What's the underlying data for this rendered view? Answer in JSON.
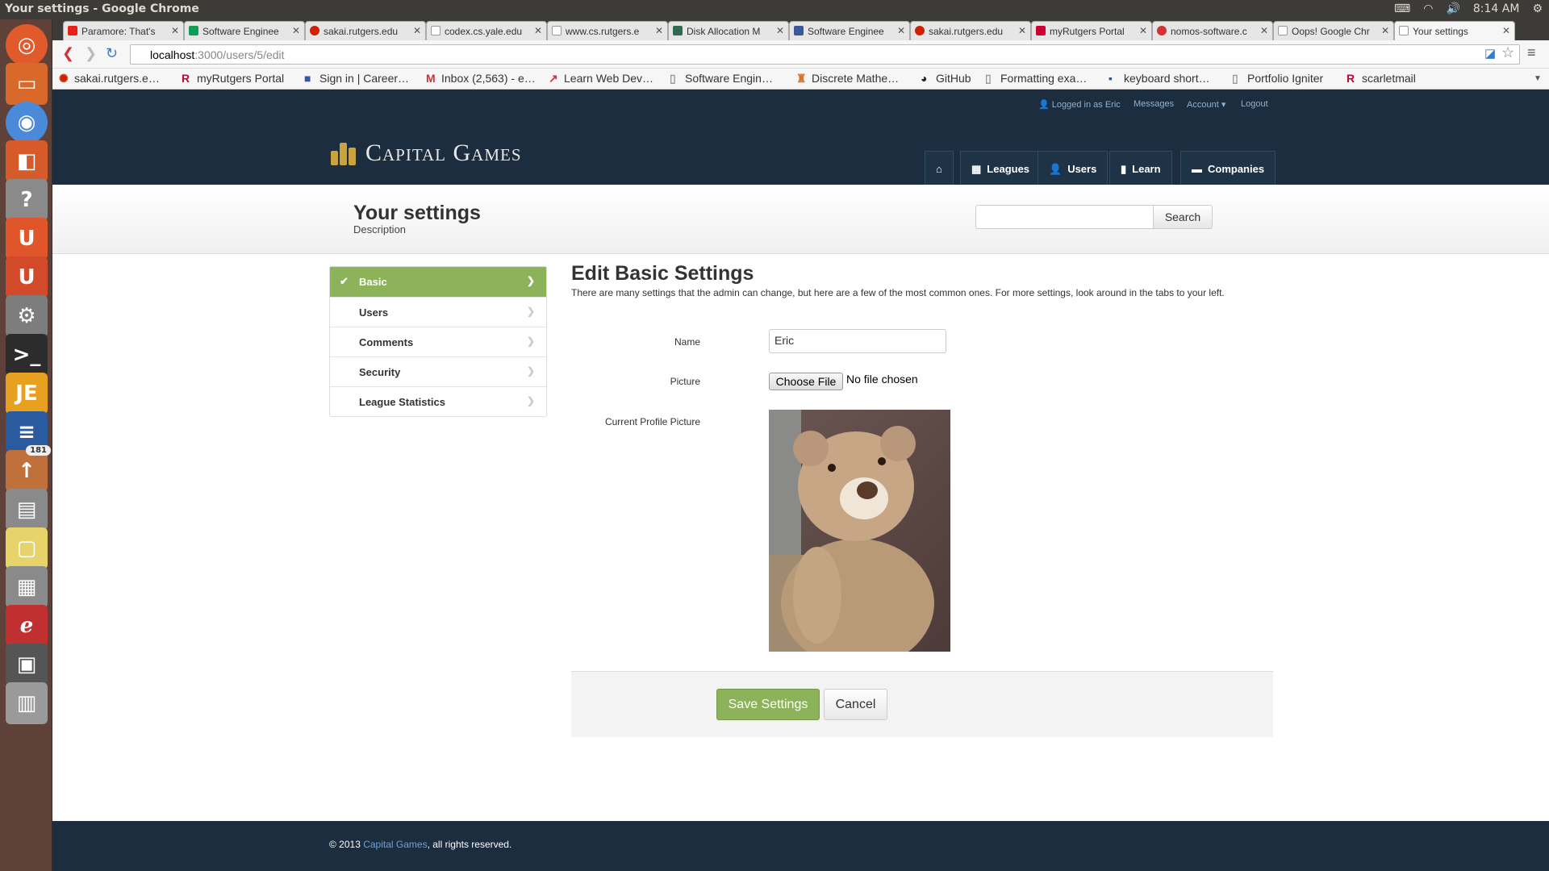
{
  "os": {
    "window_title": "Your settings - Google Chrome",
    "clock": "8:14 AM"
  },
  "launcher": {
    "badge_count": "181"
  },
  "tabs": [
    {
      "label": "Paramore: That's",
      "color": "#e62117"
    },
    {
      "label": "Software Enginee",
      "color": "#0f9d58"
    },
    {
      "label": "sakai.rutgers.edu",
      "color": "#cc2200"
    },
    {
      "label": "codex.cs.yale.edu",
      "color": "#999999"
    },
    {
      "label": "www.cs.rutgers.e",
      "color": "#999999"
    },
    {
      "label": "Disk Allocation M",
      "color": "#2f6b4f"
    },
    {
      "label": "Software Enginee",
      "color": "#3b5998"
    },
    {
      "label": "sakai.rutgers.edu",
      "color": "#cc2200"
    },
    {
      "label": "myRutgers Portal",
      "color": "#cc0033"
    },
    {
      "label": "nomos-software.c",
      "color": "#d33333"
    },
    {
      "label": "Oops! Google Chr",
      "color": "#999999"
    },
    {
      "label": "Your settings",
      "color": "#999999"
    }
  ],
  "address_bar": {
    "host": "localhost",
    "path": ":3000/users/5/edit"
  },
  "bookmarks": [
    {
      "label": "sakai.rutgers.e…",
      "icon": "sakai-icon"
    },
    {
      "label": "myRutgers Portal",
      "icon": "rutgers-r-icon"
    },
    {
      "label": "Sign in | Career…",
      "icon": "career-icon"
    },
    {
      "label": "Inbox (2,563) - e…",
      "icon": "gmail-icon"
    },
    {
      "label": "Learn Web Dev…",
      "icon": "webdev-icon"
    },
    {
      "label": "Software Engin…",
      "icon": "page-icon"
    },
    {
      "label": "Discrete Mathe…",
      "icon": "princeton-icon"
    },
    {
      "label": "GitHub",
      "icon": "github-icon"
    },
    {
      "label": "Formatting exa…",
      "icon": "page-icon"
    },
    {
      "label": "keyboard short…",
      "icon": "bookmark-icon"
    },
    {
      "label": "Portfolio Igniter",
      "icon": "page-icon"
    },
    {
      "label": "scarletmail",
      "icon": "rutgers-r-icon"
    }
  ],
  "topnav": {
    "logged_in": "Logged in as Eric",
    "messages": "Messages",
    "account": "Account",
    "logout": "Logout"
  },
  "brand": "Capital Games",
  "mainnav": [
    {
      "label": "",
      "icon": "home-icon"
    },
    {
      "label": "Leagues",
      "icon": "grid-icon"
    },
    {
      "label": "Users",
      "icon": "user-icon"
    },
    {
      "label": "Learn",
      "icon": "book-icon"
    },
    {
      "label": "Companies",
      "icon": "briefcase-icon"
    }
  ],
  "page_header": {
    "title": "Your settings",
    "description": "Description",
    "search_button": "Search"
  },
  "sidenav": [
    {
      "label": "Basic",
      "active": true
    },
    {
      "label": "Users",
      "active": false
    },
    {
      "label": "Comments",
      "active": false
    },
    {
      "label": "Security",
      "active": false
    },
    {
      "label": "League Statistics",
      "active": false
    }
  ],
  "form": {
    "title": "Edit Basic Settings",
    "intro": "There are many settings that the admin can change, but here are a few of the most common ones. For more settings, look around in the tabs to your left.",
    "name_label": "Name",
    "name_value": "Eric",
    "picture_label": "Picture",
    "choose_file": "Choose File",
    "no_file": "No file chosen",
    "current_picture_label": "Current Profile Picture",
    "save": "Save Settings",
    "cancel": "Cancel"
  },
  "footer": {
    "prefix": "© 2013 ",
    "link": "Capital Games",
    "suffix": ", all rights reserved."
  },
  "colors": {
    "accent_green": "#8cb35a",
    "navy": "#1c2d3f",
    "link_blue": "#6fa3d4"
  }
}
